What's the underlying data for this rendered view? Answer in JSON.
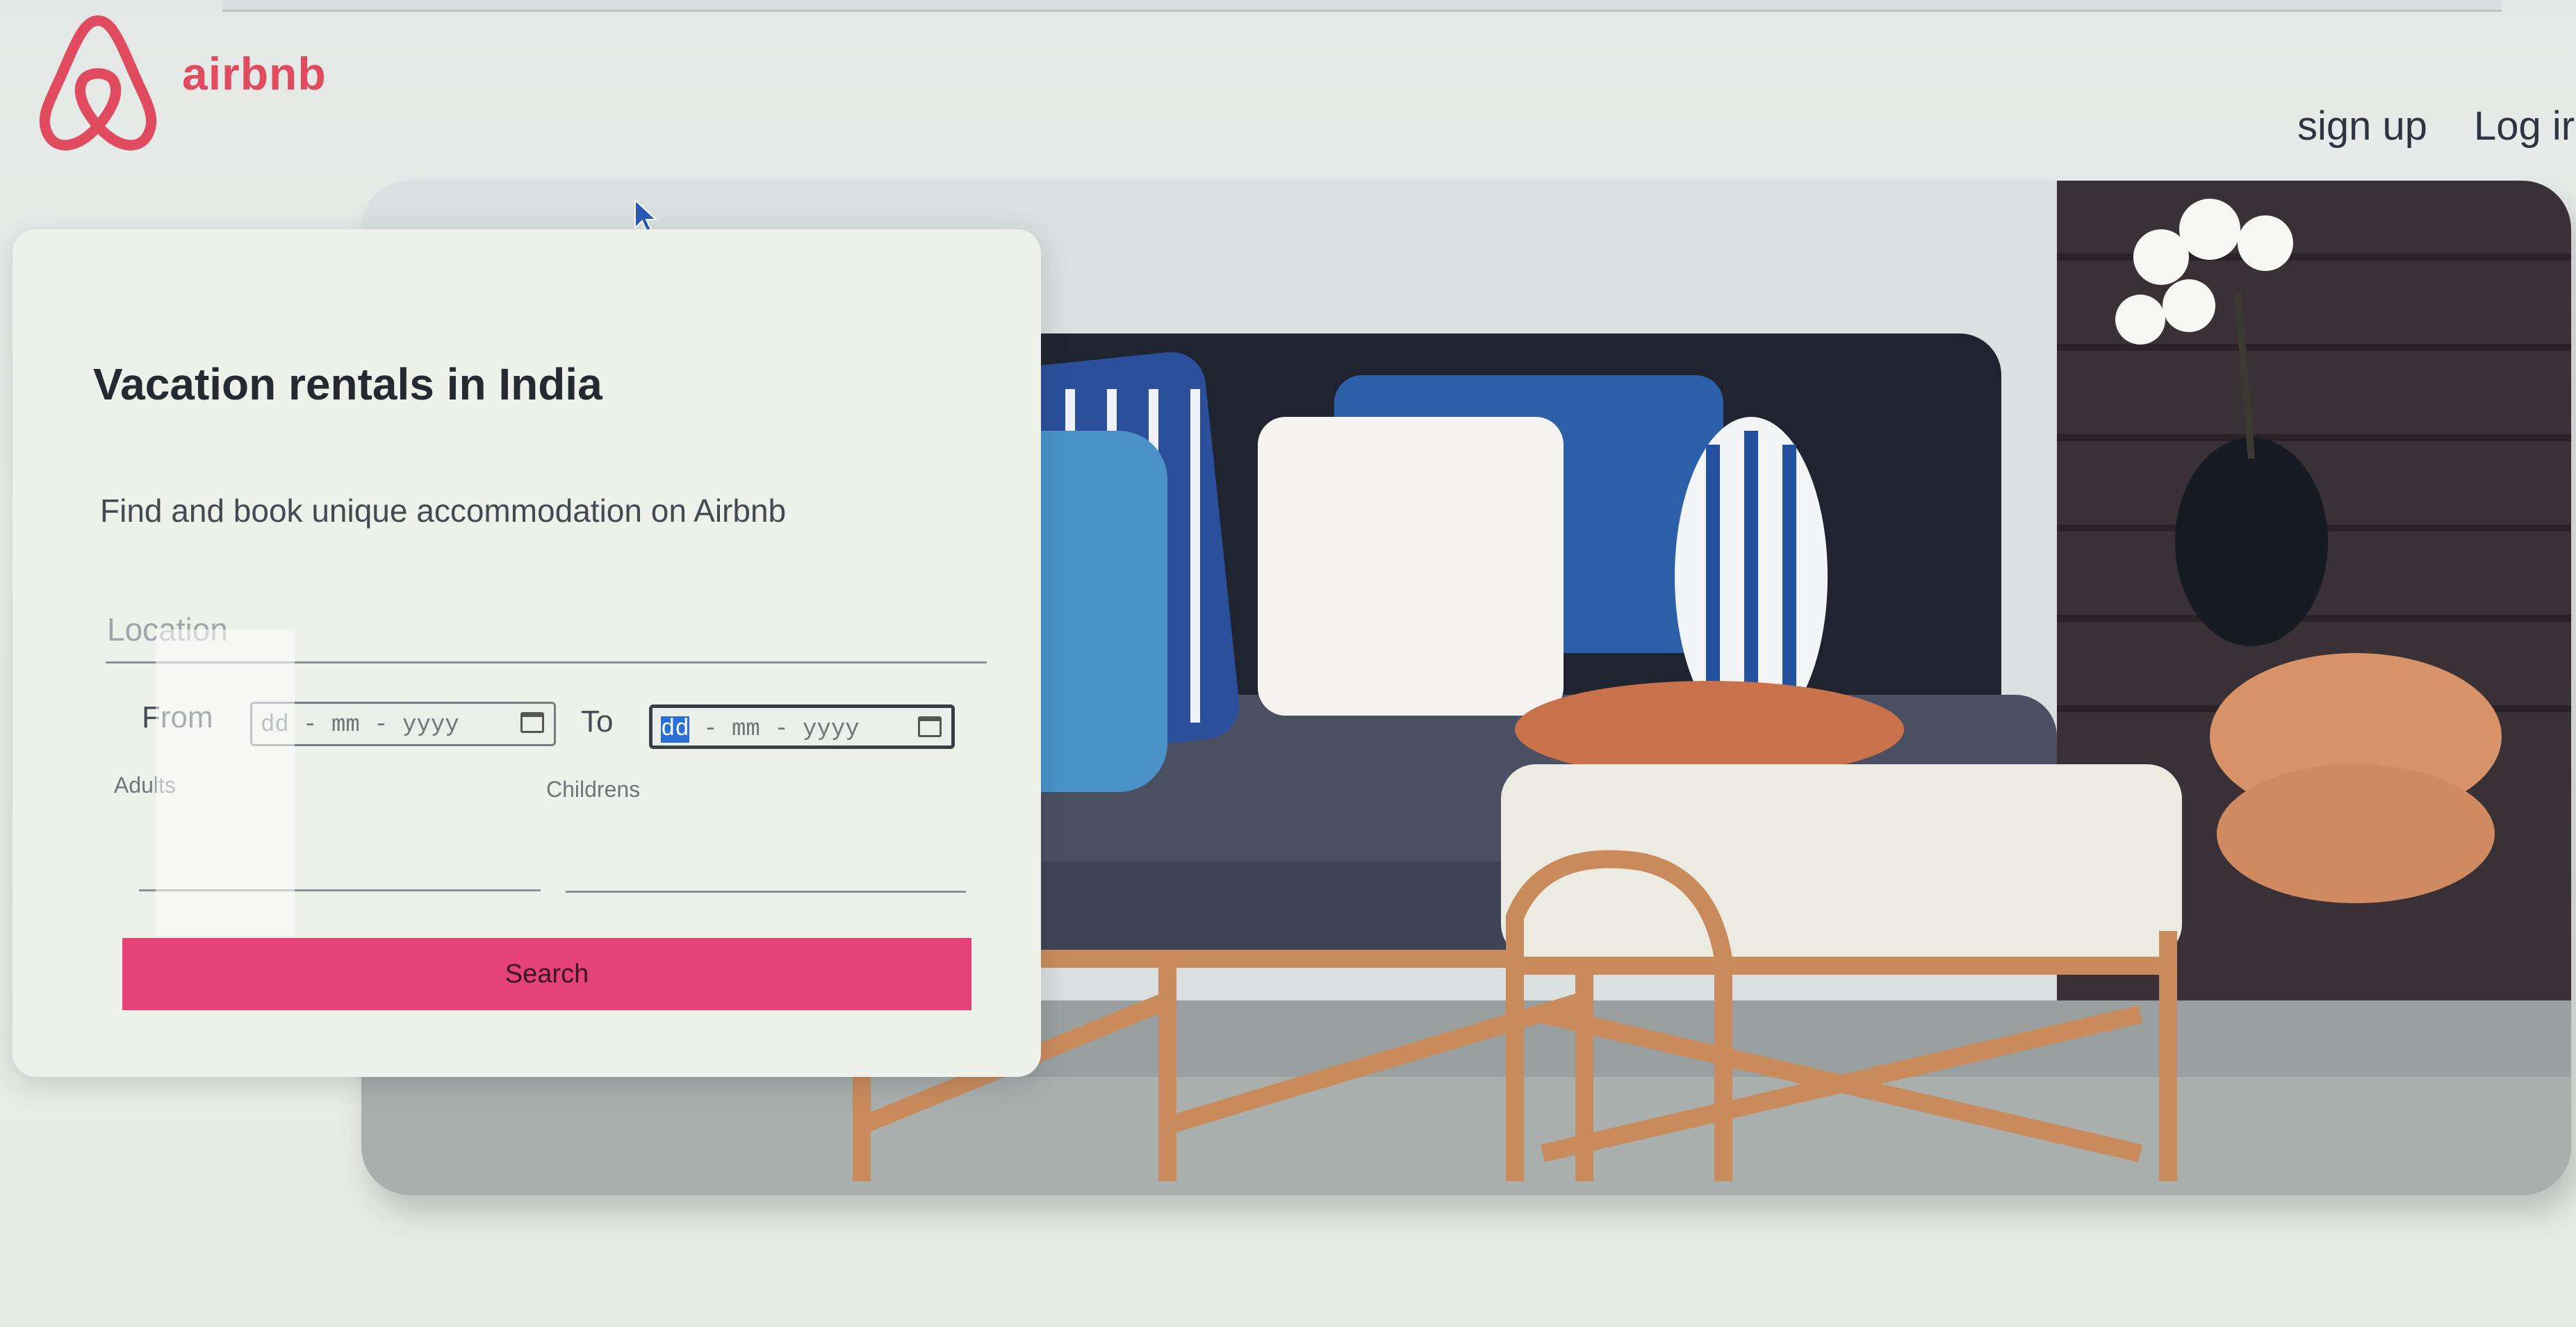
{
  "header": {
    "brand": "airbnb",
    "nav": {
      "signup": "sign up",
      "login": "Log ir"
    }
  },
  "search_card": {
    "title": "Vacation rentals in India",
    "subtitle": "Find and book unique accommodation on Airbnb",
    "location_placeholder": "Location",
    "from_label": "From",
    "to_label": "To",
    "date_from": {
      "dd": "dd",
      "rest": " - mm - yyyy"
    },
    "date_to": {
      "dd": "dd",
      "rest": " - mm - yyyy"
    },
    "adults_label": "Adults",
    "children_label": "Childrens",
    "search_button": "Search"
  },
  "colors": {
    "brand": "#e14b5f",
    "search_button": "#e6427a",
    "date_highlight": "#2a6fd8"
  }
}
